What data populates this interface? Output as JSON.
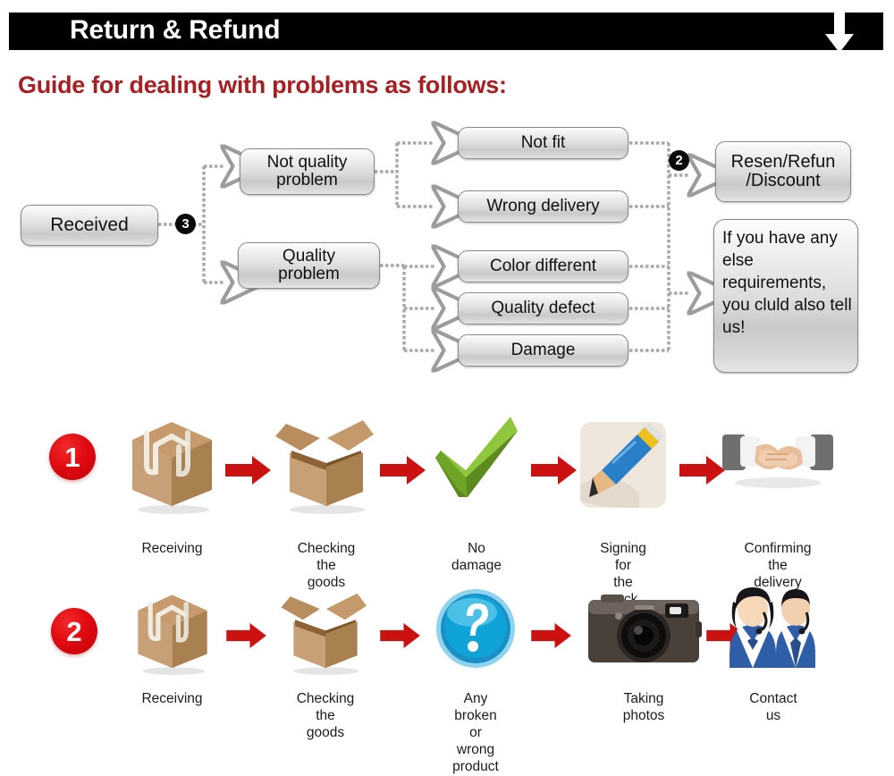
{
  "header": {
    "title": "Return & Refund",
    "arrow_icon": "down-arrow-icon",
    "bar_color": "#000000",
    "text_color": "#ffffff"
  },
  "guide": {
    "heading": "Guide for dealing with problems as follows:",
    "heading_color": "#a51f23"
  },
  "flowchart": {
    "boxes": {
      "received": "Received",
      "not_quality_problem": "Not quality\nproblem",
      "quality_problem": "Quality\nproblem",
      "not_fit": "Not fit",
      "wrong_delivery": "Wrong delivery",
      "color_different": "Color different",
      "quality_defect": "Quality defect",
      "damage": "Damage",
      "resolution": "Resen/Refun\n/Discount",
      "note": "If you have any else requirements, you cluld also tell us!"
    },
    "badges": {
      "three": "3",
      "two": "2"
    },
    "connector_icon": "dashed-arrow-connector"
  },
  "flows": [
    {
      "badge": "1",
      "badge_color": "#d8000a",
      "steps": [
        {
          "label": "Receiving",
          "icon": "closed-box-icon"
        },
        {
          "label": "Checking the\ngoods",
          "icon": "open-box-icon"
        },
        {
          "label": "No damage",
          "icon": "green-checkmark-icon"
        },
        {
          "label": "Signing for\nthe pack",
          "icon": "pencil-signing-icon"
        },
        {
          "label": "Confirming\nthe delivery",
          "icon": "handshake-icon"
        }
      ],
      "arrow_icon": "red-right-arrow-icon"
    },
    {
      "badge": "2",
      "badge_color": "#d8000a",
      "steps": [
        {
          "label": "Receiving",
          "icon": "closed-box-icon"
        },
        {
          "label": "Checking the\ngoods",
          "icon": "open-box-icon"
        },
        {
          "label": "Any broken or\nwrong product",
          "icon": "blue-question-mark-icon"
        },
        {
          "label": "Taking photos",
          "icon": "camera-icon"
        },
        {
          "label": "Contact us",
          "icon": "support-agents-icon"
        }
      ],
      "arrow_icon": "red-right-arrow-icon"
    }
  ]
}
